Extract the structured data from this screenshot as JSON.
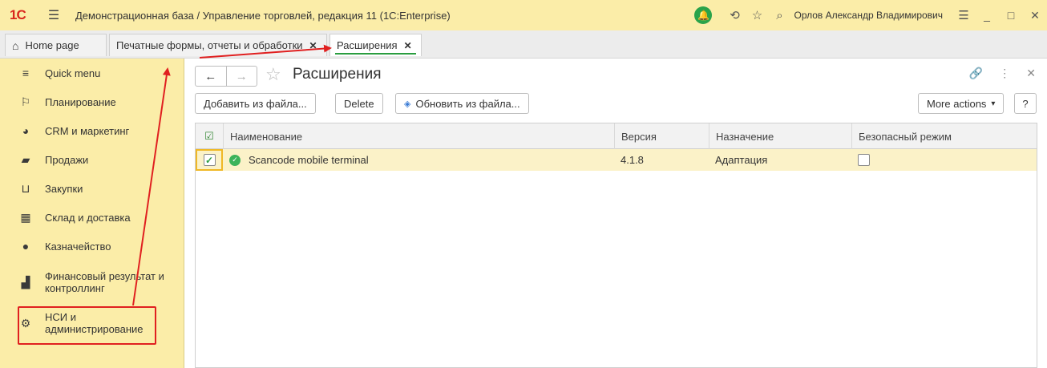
{
  "titlebar": {
    "logo": "1С",
    "title": "Демонстрационная база / Управление торговлей, редакция 11  (1С:Enterprise)",
    "user": "Орлов Александр Владимирович"
  },
  "tabs": [
    {
      "label": "Home page",
      "active": false
    },
    {
      "label": "Печатные формы, отчеты и обработки",
      "active": false
    },
    {
      "label": "Расширения",
      "active": true
    }
  ],
  "sidebar": {
    "items": [
      {
        "label": "Quick menu",
        "icon": "menu-icon"
      },
      {
        "label": "Планирование",
        "icon": "planning-icon"
      },
      {
        "label": "CRM и маркетинг",
        "icon": "pie-chart-icon"
      },
      {
        "label": "Продажи",
        "icon": "bag-icon"
      },
      {
        "label": "Закупки",
        "icon": "cart-icon"
      },
      {
        "label": "Склад и доставка",
        "icon": "warehouse-icon"
      },
      {
        "label": "Казначейство",
        "icon": "coin-icon"
      },
      {
        "label": "Финансовый результат и контроллинг",
        "icon": "bar-chart-icon"
      },
      {
        "label": "НСИ и администрирование",
        "icon": "gear-icon"
      }
    ]
  },
  "main": {
    "title": "Расширения",
    "buttons": {
      "add_from_file": "Добавить из файла...",
      "delete": "Delete",
      "update_from_file": "Обновить из файла...",
      "more_actions": "More actions",
      "help": "?"
    },
    "table": {
      "columns": [
        "Наименование",
        "Версия",
        "Назначение",
        "Безопасный режим"
      ],
      "rows": [
        {
          "active": true,
          "name": "Scancode mobile terminal",
          "version": "4.1.8",
          "purpose": "Адаптация",
          "safe_mode": false
        }
      ]
    }
  },
  "colors": {
    "accent_green": "#2a9d3f",
    "sidebar_bg": "#fbeda8",
    "annotation_red": "#e02020"
  }
}
